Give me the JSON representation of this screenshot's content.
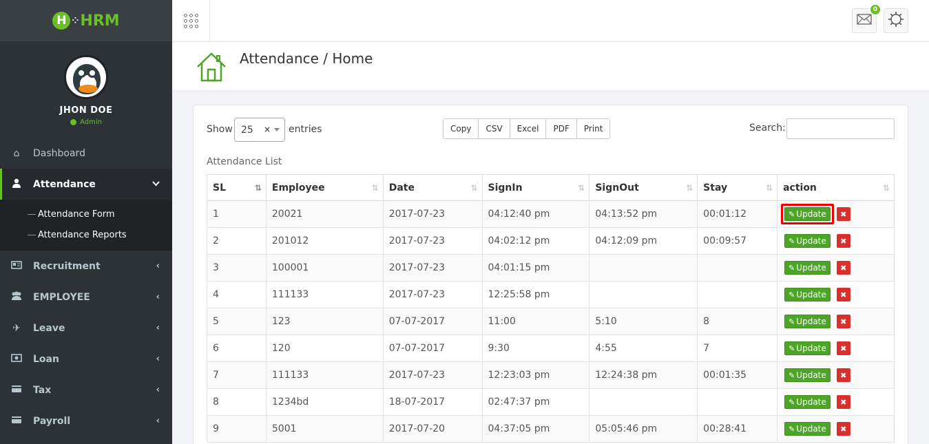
{
  "app": {
    "logo_text": "HRM",
    "logo_initial": "H"
  },
  "user": {
    "name": "JHON DOE",
    "role": "Admin"
  },
  "sidebar": {
    "items": [
      {
        "label": "Dashboard",
        "icon": "home-icon"
      },
      {
        "label": "Attendance",
        "icon": "user-icon",
        "active": true
      },
      {
        "label": "Recruitment",
        "icon": "newspaper-icon"
      },
      {
        "label": "EMPLOYEE",
        "icon": "users-icon"
      },
      {
        "label": "Leave",
        "icon": "plane-icon"
      },
      {
        "label": "Loan",
        "icon": "money-icon"
      },
      {
        "label": "Tax",
        "icon": "credit-card-icon"
      },
      {
        "label": "Payroll",
        "icon": "credit-card-icon"
      }
    ],
    "submenu": [
      "Attendance Form",
      "Attendance Reports"
    ]
  },
  "header": {
    "mail_count": "0"
  },
  "page": {
    "title": "Attendance / Home"
  },
  "controls": {
    "show_label": "Show",
    "entries_value": "25",
    "entries_label": "entries",
    "export_buttons": [
      "Copy",
      "CSV",
      "Excel",
      "PDF",
      "Print"
    ],
    "search_label": "Search:"
  },
  "table": {
    "title": "Attendance List",
    "columns": [
      "SL",
      "Employee",
      "Date",
      "SignIn",
      "SignOut",
      "Stay",
      "action"
    ],
    "update_label": "Update",
    "rows": [
      [
        "1",
        "20021",
        "2017-07-23",
        "04:12:40 pm",
        "04:13:52 pm",
        "00:01:12"
      ],
      [
        "2",
        "201012",
        "2017-07-23",
        "04:02:12 pm",
        "04:12:09 pm",
        "00:09:57"
      ],
      [
        "3",
        "100001",
        "2017-07-23",
        "04:01:15 pm",
        "",
        ""
      ],
      [
        "4",
        "111133",
        "2017-07-23",
        "12:25:58 pm",
        "",
        ""
      ],
      [
        "5",
        "123",
        "07-07-2017",
        "11:00",
        "5:10",
        "8"
      ],
      [
        "6",
        "120",
        "07-07-2017",
        "9:30",
        "4:55",
        "7"
      ],
      [
        "7",
        "111133",
        "2017-07-23",
        "12:23:03 pm",
        "12:24:38 pm",
        "00:01:35"
      ],
      [
        "8",
        "1234bd",
        "18-07-2017",
        "02:47:37 pm",
        "",
        ""
      ],
      [
        "9",
        "5001",
        "2017-07-20",
        "04:37:05 pm",
        "05:05:46 pm",
        "00:28:41"
      ]
    ]
  },
  "colors": {
    "accent": "#6bbf26",
    "sidebar": "#2d3236",
    "update": "#4ca526",
    "delete": "#d9302d"
  }
}
